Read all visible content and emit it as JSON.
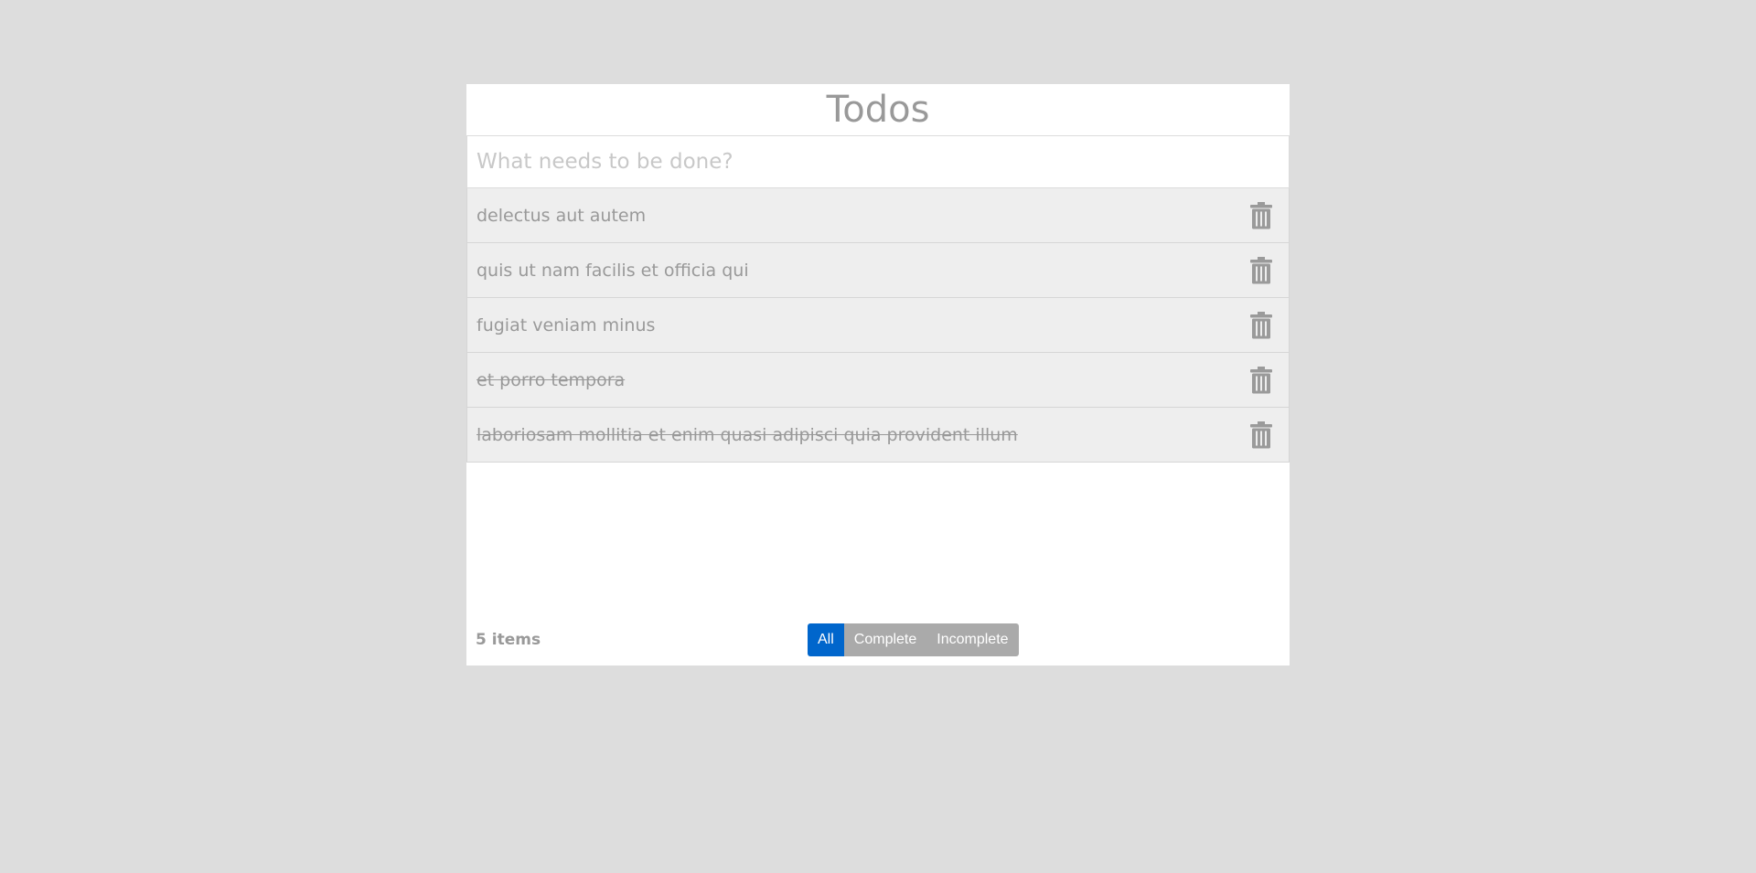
{
  "app": {
    "title": "Todos"
  },
  "new_todo": {
    "placeholder": "What needs to be done?",
    "value": ""
  },
  "todos": [
    {
      "text": "delectus aut autem",
      "completed": false,
      "delete_icon": "trash-icon"
    },
    {
      "text": "quis ut nam facilis et officia qui",
      "completed": false,
      "delete_icon": "trash-icon"
    },
    {
      "text": "fugiat veniam minus",
      "completed": false,
      "delete_icon": "trash-icon"
    },
    {
      "text": "et porro tempora",
      "completed": true,
      "delete_icon": "trash-icon"
    },
    {
      "text": "laboriosam mollitia et enim quasi adipisci quia provident illum",
      "completed": true,
      "delete_icon": "trash-icon"
    }
  ],
  "footer": {
    "count_label": "5 items",
    "filters": [
      {
        "label": "All",
        "active": true
      },
      {
        "label": "Complete",
        "active": false
      },
      {
        "label": "Incomplete",
        "active": false
      }
    ]
  },
  "colors": {
    "background": "#dddddd",
    "text": "#999999",
    "item_background": "#eeeeee",
    "filter_active": "#0066cc",
    "filter_inactive": "#aaaaaa"
  }
}
